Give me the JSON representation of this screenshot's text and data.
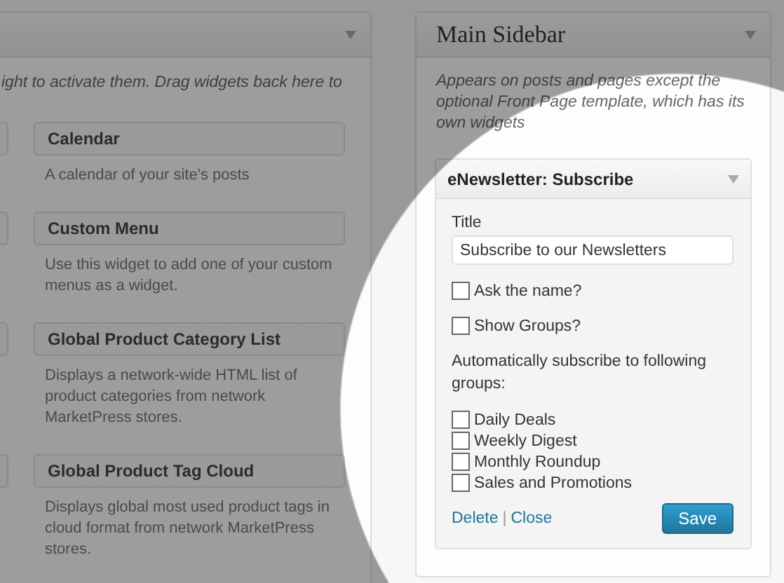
{
  "available_widgets": {
    "description": "ight to activate them. Drag widgets back here to",
    "widgets": [
      {
        "title": "Calendar",
        "description": "A calendar of your site's posts"
      },
      {
        "title": "Custom Menu",
        "description": "Use this widget to add one of your custom menus as a widget."
      },
      {
        "title": "Global Product Category List",
        "description": "Displays a network-wide HTML list of product categories from network MarketPress stores."
      },
      {
        "title": "Global Product Tag Cloud",
        "description": "Displays global most used product tags in cloud format from network MarketPress stores."
      }
    ]
  },
  "sidebar": {
    "title": "Main Sidebar",
    "description": "Appears on posts and pages except the optional Front Page template, which has its own widgets",
    "widget": {
      "title": "eNewsletter: Subscribe",
      "field_label": "Title",
      "field_value": "Subscribe to our Newsletters",
      "options": [
        {
          "label": "Ask the name?",
          "checked": false
        },
        {
          "label": "Show Groups?",
          "checked": false
        }
      ],
      "groups_label": "Automatically subscribe to following groups:",
      "groups": [
        {
          "label": "Daily Deals",
          "checked": false
        },
        {
          "label": "Weekly Digest",
          "checked": false
        },
        {
          "label": "Monthly Roundup",
          "checked": false
        },
        {
          "label": "Sales and Promotions",
          "checked": false
        }
      ],
      "links": [
        "Delete",
        "Close"
      ],
      "link_separator": "|",
      "save_button": "Save"
    }
  }
}
